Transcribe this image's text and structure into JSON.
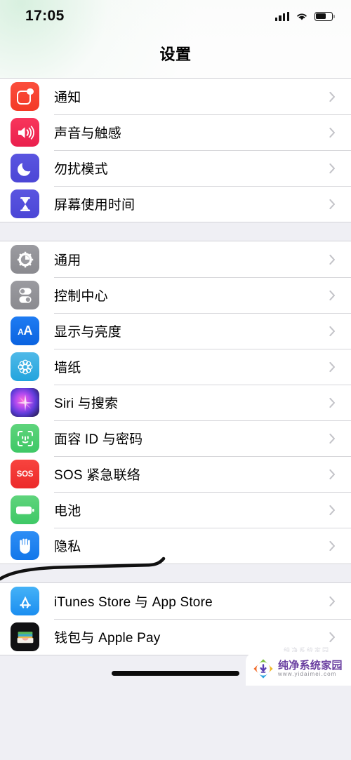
{
  "status_bar": {
    "time": "17:05",
    "signal_icon": "cellular-signal-icon",
    "signal_bars": 4,
    "wifi_icon": "wifi-icon",
    "battery_icon": "battery-icon",
    "battery_level_percent": 65
  },
  "nav": {
    "title": "设置"
  },
  "colors": {
    "page_background": "#EFEFF4",
    "row_background": "#FFFFFF",
    "separator": "#d6d6da",
    "chevron": "#c3c3c8",
    "label_text": "#000000",
    "annotation_stroke": "#111111",
    "watermark_title": "#6a3fa0"
  },
  "groups": [
    {
      "name": "notifications-group",
      "rows": [
        {
          "label": "通知",
          "icon": "notifications-icon",
          "icon_color": "#fb4e3c",
          "chevron": "chevron-right-icon"
        },
        {
          "label": "声音与触感",
          "icon": "sounds-haptics-icon",
          "icon_color": "#f8365b",
          "chevron": "chevron-right-icon"
        },
        {
          "label": "勿扰模式",
          "icon": "do-not-disturb-moon-icon",
          "icon_color": "#5a55e0",
          "chevron": "chevron-right-icon"
        },
        {
          "label": "屏幕使用时间",
          "icon": "screen-time-hourglass-icon",
          "icon_color": "#5a55e0",
          "chevron": "chevron-right-icon"
        }
      ]
    },
    {
      "name": "system-group",
      "rows": [
        {
          "label": "通用",
          "icon": "general-gear-icon",
          "icon_color": "#9b9ba0",
          "chevron": "chevron-right-icon"
        },
        {
          "label": "控制中心",
          "icon": "control-center-toggles-icon",
          "icon_color": "#9b9ba0",
          "chevron": "chevron-right-icon"
        },
        {
          "label": "显示与亮度",
          "icon": "display-brightness-aa-icon",
          "icon_color": "#1f7cf2",
          "chevron": "chevron-right-icon"
        },
        {
          "label": "墙纸",
          "icon": "wallpaper-flower-icon",
          "icon_color": "#4fb9e8",
          "chevron": "chevron-right-icon"
        },
        {
          "label": "Siri 与搜索",
          "icon": "siri-orb-icon",
          "icon_color": "#b44bf0",
          "chevron": "chevron-right-icon"
        },
        {
          "label": "面容 ID 与密码",
          "icon": "face-id-icon",
          "icon_color": "#5fd47c",
          "chevron": "chevron-right-icon"
        },
        {
          "label": "SOS 紧急联络",
          "icon": "emergency-sos-icon",
          "icon_color": "#f8443f",
          "chevron": "chevron-right-icon"
        },
        {
          "label": "电池",
          "icon": "battery-settings-icon",
          "icon_color": "#5fd47c",
          "chevron": "chevron-right-icon"
        },
        {
          "label": "隐私",
          "icon": "privacy-hand-icon",
          "icon_color": "#2e8ef5",
          "chevron": "chevron-right-icon"
        }
      ]
    },
    {
      "name": "store-group",
      "rows": [
        {
          "label": "iTunes Store 与 App Store",
          "icon": "app-store-icon",
          "icon_color": "#45b2f7",
          "chevron": "chevron-right-icon"
        },
        {
          "label": "钱包与 Apple Pay",
          "icon": "wallet-apple-pay-icon",
          "icon_color": "#111113",
          "chevron": "chevron-right-icon"
        }
      ]
    }
  ],
  "annotation": {
    "name": "handwritten-underline-battery",
    "target_row_label": "电池",
    "stroke_color": "#111111"
  },
  "bottom": {
    "home_indicator": "home-indicator"
  },
  "watermark": {
    "title": "纯净系统家园",
    "url": "www.yidaimei.com",
    "logo_icon": "download-arrow-logo-icon",
    "ghost_text": "纯净系统家园"
  }
}
